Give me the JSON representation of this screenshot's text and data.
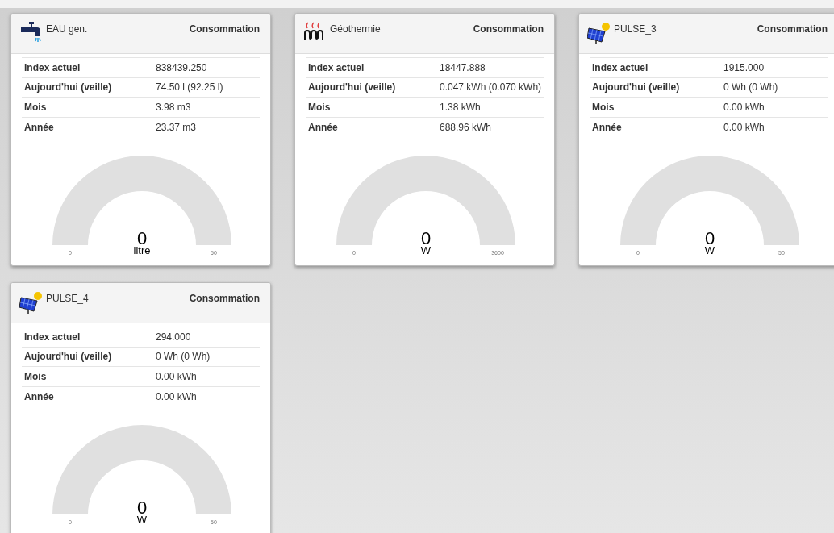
{
  "cards": [
    {
      "kind": "tap",
      "name": "EAU gen.",
      "header_label": "Consommation",
      "rows": [
        {
          "label": "Index actuel",
          "value": "838439.250"
        },
        {
          "label": "Aujourd'hui (veille)",
          "value": "74.50 l (92.25 l)"
        },
        {
          "label": "Mois",
          "value": "3.98 m3"
        },
        {
          "label": "Année",
          "value": "23.37 m3"
        }
      ],
      "gauge": {
        "value": "0",
        "unit": "litre",
        "min": "0",
        "max": "50"
      }
    },
    {
      "kind": "geothermal",
      "name": "Géothermie",
      "header_label": "Consommation",
      "rows": [
        {
          "label": "Index actuel",
          "value": "18447.888"
        },
        {
          "label": "Aujourd'hui (veille)",
          "value": "0.047 kWh (0.070 kWh)"
        },
        {
          "label": "Mois",
          "value": "1.38 kWh"
        },
        {
          "label": "Année",
          "value": "688.96 kWh"
        }
      ],
      "gauge": {
        "value": "0",
        "unit": "W",
        "min": "0",
        "max": "3600"
      }
    },
    {
      "kind": "solar",
      "name": "PULSE_3",
      "header_label": "Consommation",
      "rows": [
        {
          "label": "Index actuel",
          "value": "1915.000"
        },
        {
          "label": "Aujourd'hui (veille)",
          "value": "0 Wh (0 Wh)"
        },
        {
          "label": "Mois",
          "value": "0.00 kWh"
        },
        {
          "label": "Année",
          "value": "0.00 kWh"
        }
      ],
      "gauge": {
        "value": "0",
        "unit": "W",
        "min": "0",
        "max": "50"
      }
    },
    {
      "kind": "solar",
      "name": "PULSE_4",
      "header_label": "Consommation",
      "rows": [
        {
          "label": "Index actuel",
          "value": "294.000"
        },
        {
          "label": "Aujourd'hui (veille)",
          "value": "0 Wh (0 Wh)"
        },
        {
          "label": "Mois",
          "value": "0.00 kWh"
        },
        {
          "label": "Année",
          "value": "0.00 kWh"
        }
      ],
      "gauge": {
        "value": "0",
        "unit": "W",
        "min": "0",
        "max": "50"
      }
    }
  ]
}
